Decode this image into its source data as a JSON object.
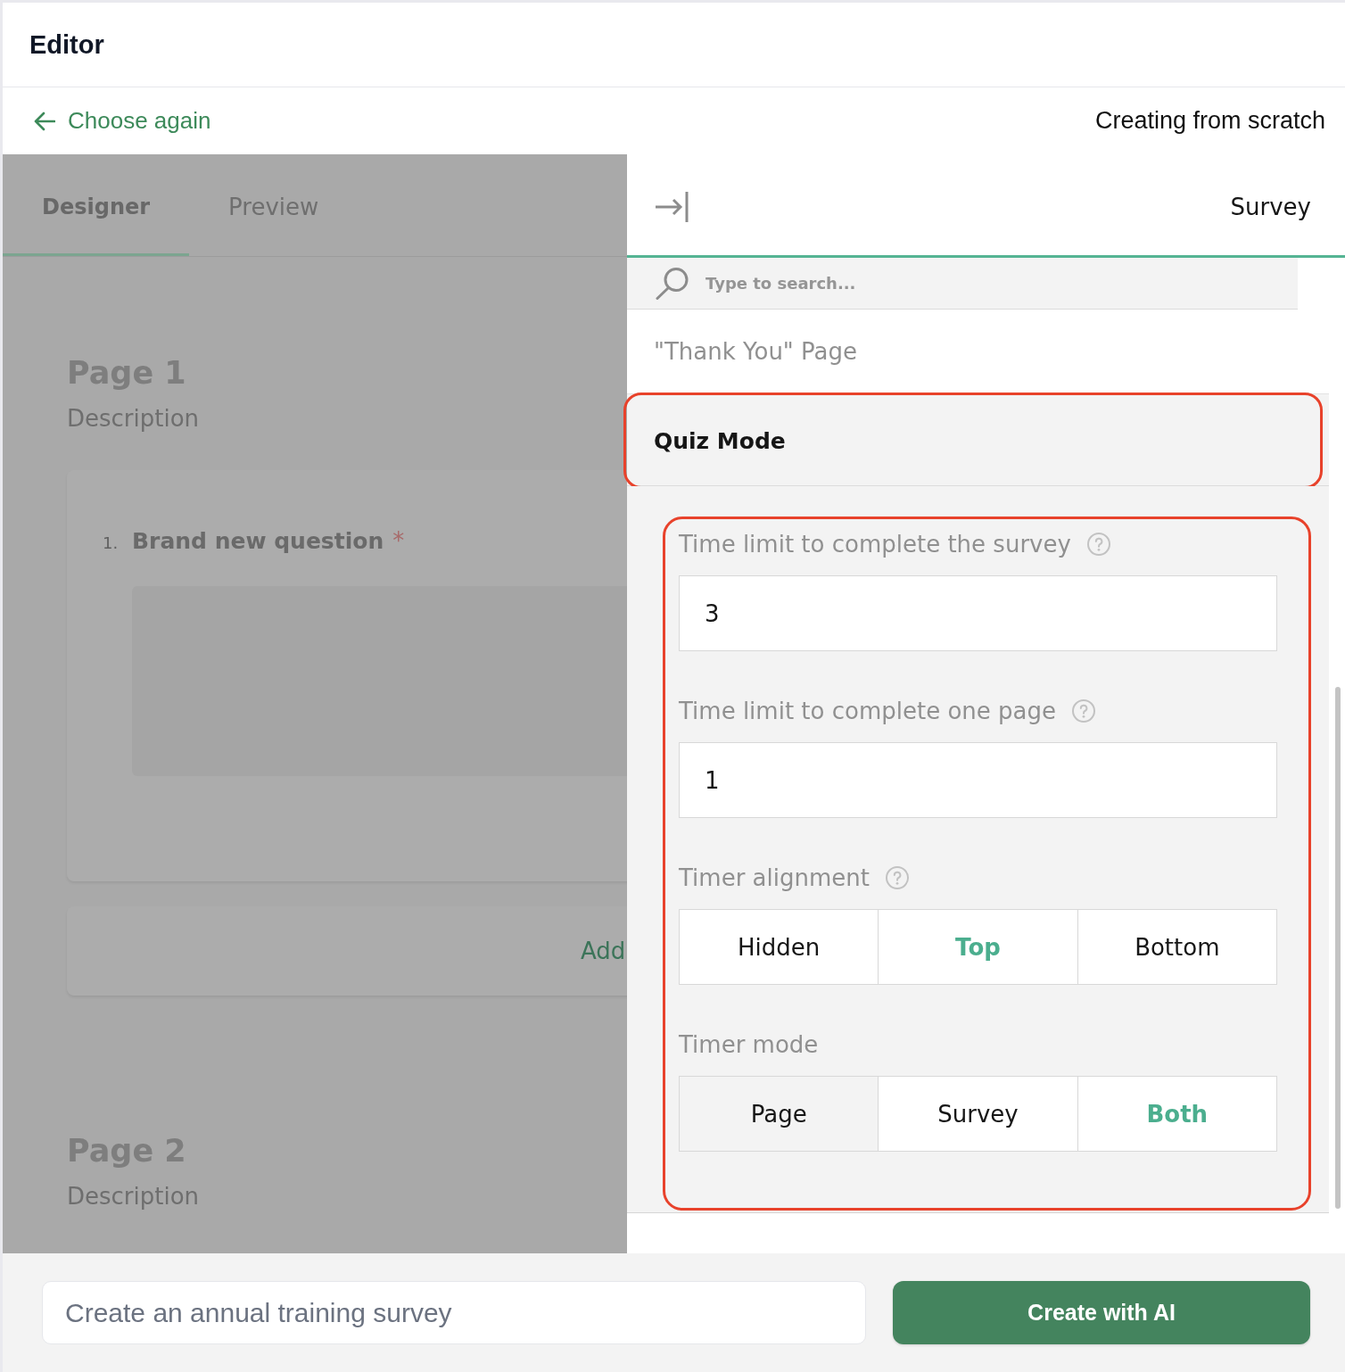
{
  "header": {
    "title": "Editor"
  },
  "toolbar": {
    "back_link": "Choose again",
    "mode_label": "Creating from scratch"
  },
  "designer": {
    "tabs": [
      {
        "label": "Designer",
        "selected": true
      },
      {
        "label": "Preview",
        "selected": false
      }
    ],
    "pages": [
      {
        "title": "Page 1",
        "description": "Description",
        "questions": [
          {
            "number": "1.",
            "title": "Brand new question",
            "required_mark": "*"
          }
        ],
        "add_button": "Add"
      },
      {
        "title": "Page 2",
        "description": "Description"
      }
    ]
  },
  "property_grid": {
    "title": "Survey",
    "search": {
      "placeholder": "Type to search..."
    },
    "categories": [
      {
        "title": "\"Thank You\" Page",
        "expanded": false,
        "highlighted": false
      },
      {
        "title": "Quiz Mode",
        "expanded": true,
        "highlighted": true,
        "content_highlighted": true,
        "properties": [
          {
            "kind": "number",
            "label": "Time limit to complete the survey",
            "help": true,
            "value": "3"
          },
          {
            "kind": "number",
            "label": "Time limit to complete one page",
            "help": true,
            "value": "1"
          },
          {
            "kind": "button_group",
            "label": "Timer alignment",
            "help": true,
            "options": [
              {
                "label": "Hidden",
                "selected": false,
                "hovered": false
              },
              {
                "label": "Top",
                "selected": true,
                "hovered": false
              },
              {
                "label": "Bottom",
                "selected": false,
                "hovered": false
              }
            ]
          },
          {
            "kind": "button_group",
            "label": "Timer mode",
            "help": false,
            "options": [
              {
                "label": "Page",
                "selected": false,
                "hovered": true
              },
              {
                "label": "Survey",
                "selected": false,
                "hovered": false
              },
              {
                "label": "Both",
                "selected": true,
                "hovered": false
              }
            ]
          }
        ]
      }
    ]
  },
  "prompt_bar": {
    "input": {
      "placeholder": "Create an annual training survey"
    },
    "button": "Create with AI"
  }
}
